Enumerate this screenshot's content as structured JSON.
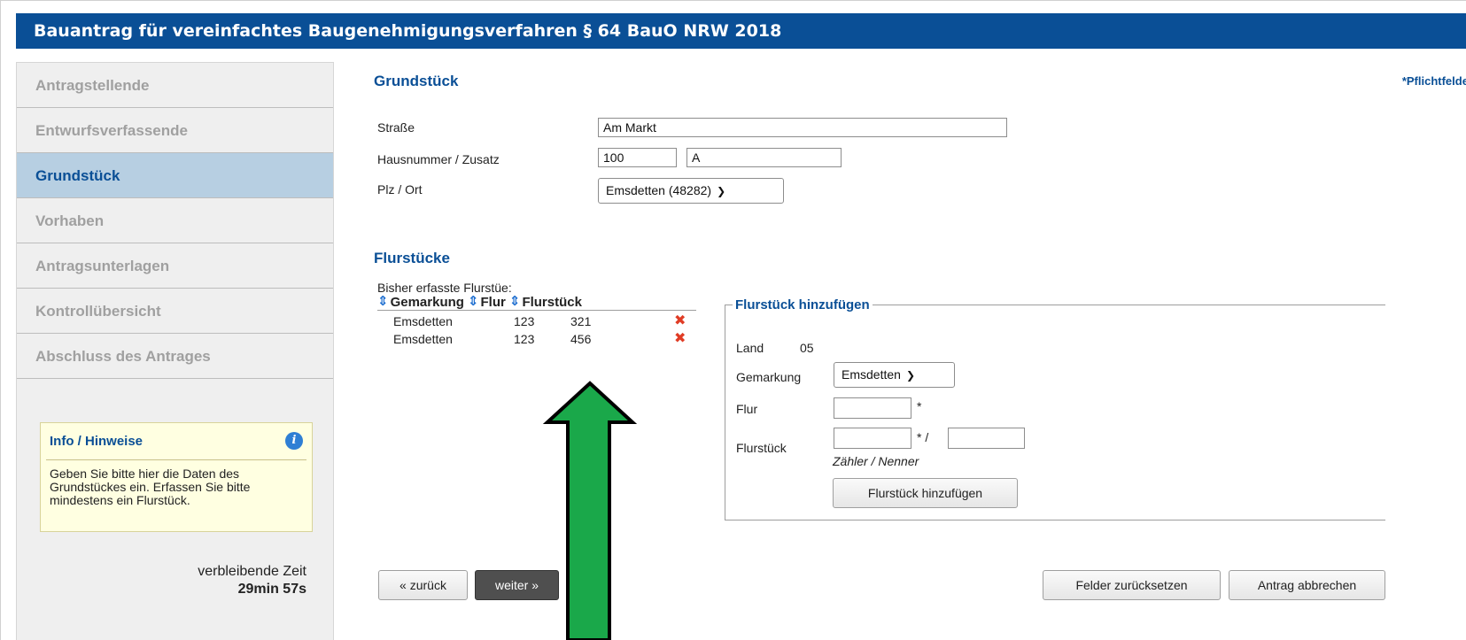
{
  "header": {
    "title": "Bauantrag für vereinfachtes Baugenehmigungsverfahren § 64 BauO NRW 2018"
  },
  "sidebar": {
    "items": [
      {
        "label": "Antragstellende"
      },
      {
        "label": "Entwurfsverfassende"
      },
      {
        "label": "Grundstück"
      },
      {
        "label": "Vorhaben"
      },
      {
        "label": "Antragsunterlagen"
      },
      {
        "label": "Kontrollübersicht"
      },
      {
        "label": "Abschluss des Antrages"
      }
    ],
    "info": {
      "title": "Info / Hinweise",
      "icon": "info-icon",
      "text": "Geben Sie bitte hier die Daten des Grundstückes ein. Erfassen Sie bitte mindestens ein Flurstück."
    },
    "timer": {
      "label": "verbleibende Zeit",
      "value": "29min 57s"
    }
  },
  "main": {
    "section_title": "Grundstück",
    "required_note": "*Pflichtfelder",
    "street": {
      "label": "Straße",
      "value": "Am Markt"
    },
    "house": {
      "label": "Hausnummer / Zusatz",
      "number": "100",
      "suffix": "A"
    },
    "city": {
      "label": "Plz / Ort",
      "value": "Emsdetten (48282)"
    },
    "parcels_title": "Flurstücke",
    "parcel_table": {
      "caption": "Bisher erfasste Flurstüe:",
      "columns": [
        "Gemarkung",
        "Flur",
        "Flurstück"
      ],
      "rows": [
        {
          "gemarkung": "Emsdetten",
          "flur": "123",
          "flurstueck": "321"
        },
        {
          "gemarkung": "Emsdetten",
          "flur": "123",
          "flurstueck": "456"
        }
      ]
    },
    "add_parcel": {
      "legend": "Flurstück hinzufügen",
      "land_label": "Land",
      "land_value": "05",
      "gemarkung_label": "Gemarkung",
      "gemarkung_value": "Emsdetten",
      "flur_label": "Flur",
      "flur_star": "*",
      "flurstueck_label": "Flurstück",
      "flurstueck_star": "* /",
      "hint": "Zähler / Nenner",
      "button": "Flurstück hinzufügen"
    },
    "buttons": {
      "back": "« zurück",
      "next": "weiter »",
      "reset": "Felder zurücksetzen",
      "cancel": "Antrag abbrechen"
    }
  },
  "colors": {
    "brand": "#0a4f96",
    "arrow": "#1aa84a",
    "delete": "#e03c25"
  }
}
